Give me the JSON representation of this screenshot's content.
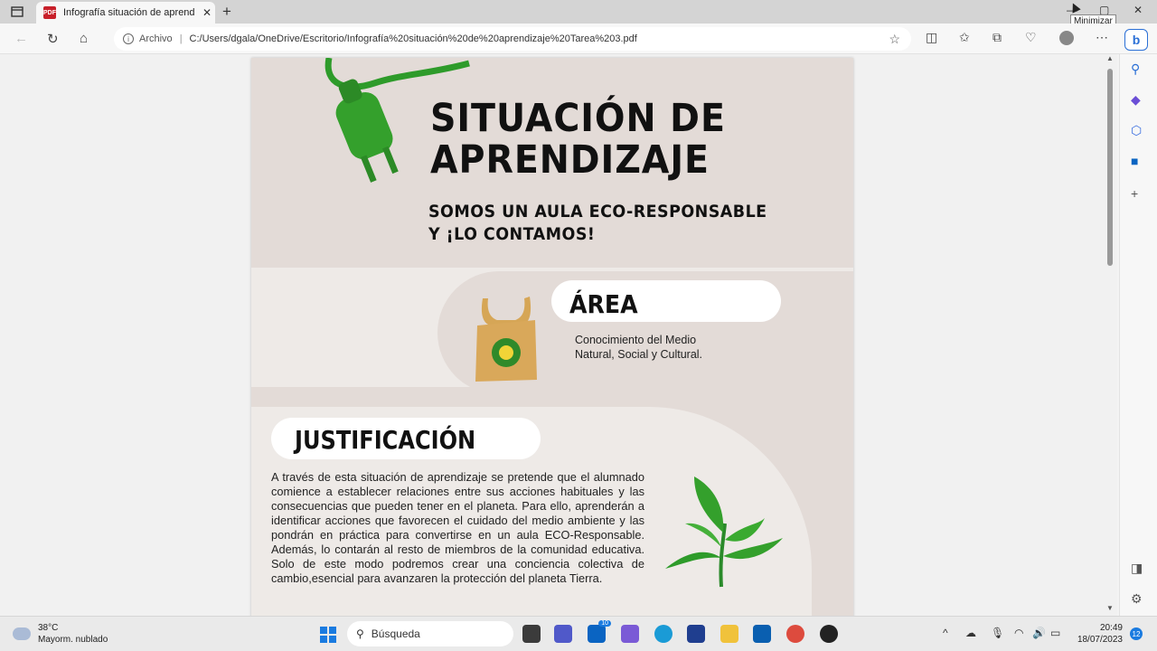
{
  "browser": {
    "tab_title": "Infografía situación de aprendiza",
    "tab_close": "✕",
    "new_tab": "+",
    "file_label": "Archivo",
    "url": "C:/Users/dgala/OneDrive/Escritorio/Infografía%20situación%20de%20aprendizaje%20Tarea%203.pdf",
    "tooltip": "Minimizar"
  },
  "document": {
    "title_line1": "SITUACIÓN DE",
    "title_line2": "APRENDIZAJE",
    "subtitle_line1": "SOMOS UN AULA ECO-RESPONSABLE",
    "subtitle_line2": "Y ¡LO CONTAMOS!",
    "area_heading": "ÁREA",
    "area_text_line1": "Conocimiento del Medio",
    "area_text_line2": "Natural, Social y Cultural.",
    "justification_heading": "JUSTIFICACIÓN",
    "justification_text": "A través de esta situación de aprendizaje se pretende que el alumnado comience a establecer relaciones entre sus acciones habituales y las consecuencias que pueden tener en el planeta. Para ello, aprenderán a identificar acciones que favorecen el cuidado del medio ambiente y las pondrán en práctica para convertirse en un aula ECO-Responsable. Además, lo contarán al resto de miembros de la comunidad educativa. Solo de este modo podremos crear una conciencia colectiva de cambio,esencial para avanzaren la protección del planeta Tierra."
  },
  "taskbar": {
    "temp": "38°C",
    "weather": "Mayorm. nublado",
    "search_label": "Búsqueda",
    "mail_badge": "10",
    "time": "20:49",
    "date": "18/07/2023",
    "notifications": "12"
  },
  "colors": {
    "page_bg": "#e3dbd7",
    "accent_green": "#2e9b2a",
    "edge_blue": "#2a6fd6"
  }
}
